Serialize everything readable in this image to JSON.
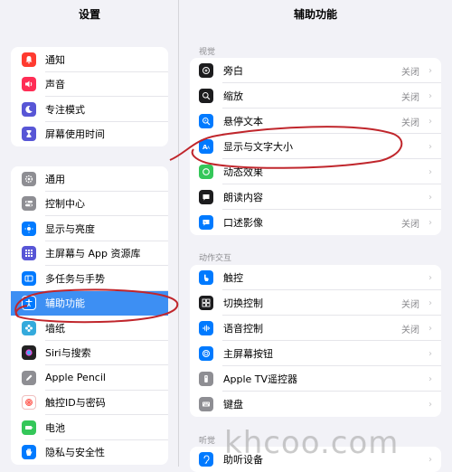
{
  "sidebar": {
    "title": "设置",
    "group1": [
      {
        "label": "通知",
        "icon": "bell-icon",
        "color": "#ff3b30"
      },
      {
        "label": "声音",
        "icon": "speaker-icon",
        "color": "#ff2d55"
      },
      {
        "label": "专注模式",
        "icon": "moon-icon",
        "color": "#5856d6"
      },
      {
        "label": "屏幕使用时间",
        "icon": "hourglass-icon",
        "color": "#5856d6"
      }
    ],
    "group2": [
      {
        "label": "通用",
        "icon": "gear-icon",
        "color": "#8e8e93"
      },
      {
        "label": "控制中心",
        "icon": "switches-icon",
        "color": "#8e8e93"
      },
      {
        "label": "显示与亮度",
        "icon": "sun-icon",
        "color": "#007aff"
      },
      {
        "label": "主屏幕与 App 资源库",
        "icon": "grid-icon",
        "color": "#5856d6"
      },
      {
        "label": "多任务与手势",
        "icon": "multitask-icon",
        "color": "#007aff"
      },
      {
        "label": "辅助功能",
        "icon": "accessibility-icon",
        "color": "#007aff",
        "selected": true
      },
      {
        "label": "墙纸",
        "icon": "flower-icon",
        "color": "#34aadc"
      },
      {
        "label": "Siri与搜索",
        "icon": "siri-icon",
        "color": "#222222"
      },
      {
        "label": "Apple Pencil",
        "icon": "pencil-icon",
        "color": "#8e8e93"
      },
      {
        "label": "触控ID与密码",
        "icon": "fingerprint-icon",
        "color": "#ff3b30"
      },
      {
        "label": "电池",
        "icon": "battery-icon",
        "color": "#34c759"
      },
      {
        "label": "隐私与安全性",
        "icon": "hand-icon",
        "color": "#007aff"
      }
    ]
  },
  "main": {
    "title": "辅助功能",
    "sections": [
      {
        "header": "视觉",
        "items": [
          {
            "label": "旁白",
            "value": "关闭",
            "icon": "voiceover-icon",
            "color": "#1c1c1e"
          },
          {
            "label": "缩放",
            "value": "关闭",
            "icon": "zoom-icon",
            "color": "#1c1c1e"
          },
          {
            "label": "悬停文本",
            "value": "关闭",
            "icon": "hover-text-icon",
            "color": "#007aff"
          },
          {
            "label": "显示与文字大小",
            "value": "",
            "icon": "text-size-icon",
            "color": "#007aff"
          },
          {
            "label": "动态效果",
            "value": "",
            "icon": "motion-icon",
            "color": "#34c759"
          },
          {
            "label": "朗读内容",
            "value": "",
            "icon": "speech-icon",
            "color": "#1c1c1e"
          },
          {
            "label": "口述影像",
            "value": "关闭",
            "icon": "audio-description-icon",
            "color": "#007aff"
          }
        ]
      },
      {
        "header": "动作交互",
        "items": [
          {
            "label": "触控",
            "value": "",
            "icon": "touch-icon",
            "color": "#007aff"
          },
          {
            "label": "切换控制",
            "value": "关闭",
            "icon": "switch-control-icon",
            "color": "#1c1c1e"
          },
          {
            "label": "语音控制",
            "value": "关闭",
            "icon": "voice-control-icon",
            "color": "#007aff"
          },
          {
            "label": "主屏幕按钮",
            "value": "",
            "icon": "home-button-icon",
            "color": "#007aff"
          },
          {
            "label": "Apple TV遥控器",
            "value": "",
            "icon": "remote-icon",
            "color": "#8e8e93"
          },
          {
            "label": "键盘",
            "value": "",
            "icon": "keyboard-icon",
            "color": "#8e8e93"
          }
        ]
      },
      {
        "header": "听觉",
        "items": [
          {
            "label": "助听设备",
            "value": "",
            "icon": "ear-icon",
            "color": "#007aff"
          }
        ]
      }
    ]
  },
  "annotation_color": "#c0262c",
  "watermark": "khcoo.com"
}
